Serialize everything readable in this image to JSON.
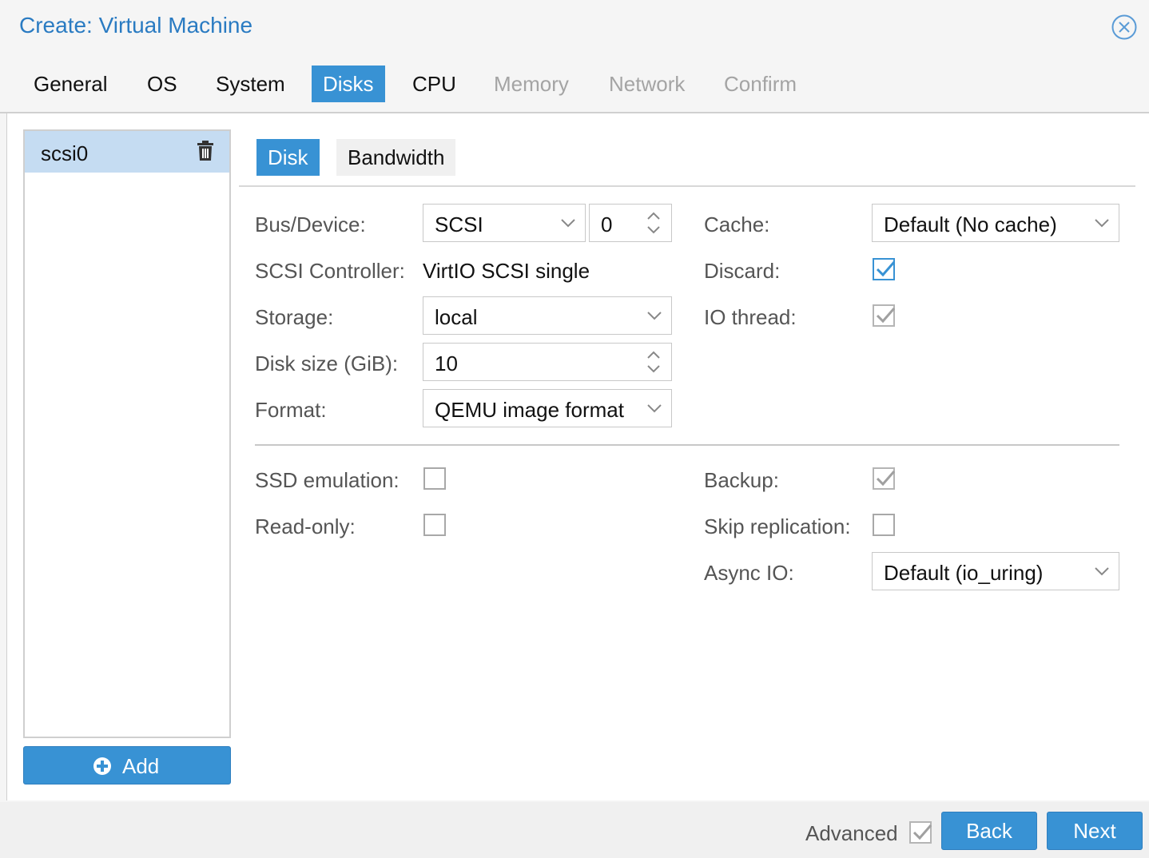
{
  "window": {
    "title": "Create: Virtual Machine"
  },
  "wizard_tabs": [
    {
      "label": "General",
      "state": "normal"
    },
    {
      "label": "OS",
      "state": "normal"
    },
    {
      "label": "System",
      "state": "normal"
    },
    {
      "label": "Disks",
      "state": "active"
    },
    {
      "label": "CPU",
      "state": "normal"
    },
    {
      "label": "Memory",
      "state": "disabled"
    },
    {
      "label": "Network",
      "state": "disabled"
    },
    {
      "label": "Confirm",
      "state": "disabled"
    }
  ],
  "disk_list": {
    "items": [
      {
        "label": "scsi0",
        "selected": true
      }
    ],
    "add_label": "Add"
  },
  "inner_tabs": [
    {
      "label": "Disk",
      "active": true
    },
    {
      "label": "Bandwidth",
      "active": false
    }
  ],
  "form": {
    "bus_device": {
      "label": "Bus/Device:",
      "bus": "SCSI",
      "device": "0"
    },
    "scsi_controller": {
      "label": "SCSI Controller:",
      "value": "VirtIO SCSI single"
    },
    "storage": {
      "label": "Storage:",
      "value": "local"
    },
    "disk_size": {
      "label": "Disk size (GiB):",
      "value": "10"
    },
    "format": {
      "label": "Format:",
      "value": "QEMU image format"
    },
    "cache": {
      "label": "Cache:",
      "value": "Default (No cache)"
    },
    "discard": {
      "label": "Discard:",
      "checked": true
    },
    "io_thread": {
      "label": "IO thread:",
      "checked": true,
      "disabled": true
    },
    "ssd_emulation": {
      "label": "SSD emulation:",
      "checked": false
    },
    "read_only": {
      "label": "Read-only:",
      "checked": false
    },
    "backup": {
      "label": "Backup:",
      "checked": true,
      "disabled": true
    },
    "skip_replication": {
      "label": "Skip replication:",
      "checked": false
    },
    "async_io": {
      "label": "Async IO:",
      "value": "Default (io_uring)"
    }
  },
  "footer": {
    "advanced_label": "Advanced",
    "advanced_checked": true,
    "back_label": "Back",
    "next_label": "Next"
  },
  "colors": {
    "accent": "#3892d4",
    "title": "#2a7bc2",
    "selected_row": "#c5dcf2"
  }
}
